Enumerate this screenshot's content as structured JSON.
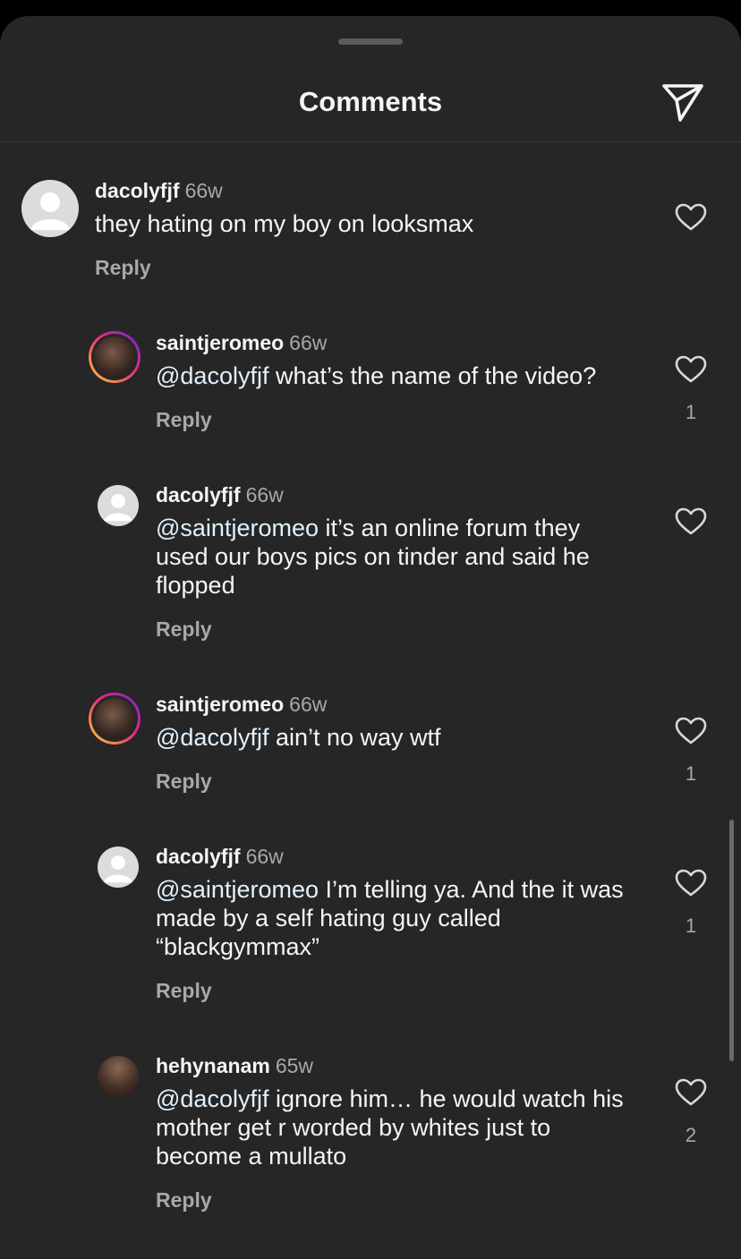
{
  "header": {
    "title": "Comments",
    "share_icon": "paper-plane-icon"
  },
  "comments": [
    {
      "username": "dacolyfjf",
      "time": "66w",
      "mention": "",
      "text": "they hating on my boy on looksmax",
      "reply_label": "Reply",
      "likes": "",
      "avatar": "default-avatar"
    },
    {
      "username": "saintjeromeo",
      "time": "66w",
      "mention": "@dacolyfjf",
      "text": " what’s the name of the video?",
      "reply_label": "Reply",
      "likes": "1",
      "avatar": "story-ring-avatar"
    },
    {
      "username": "dacolyfjf",
      "time": "66w",
      "mention": "@saintjeromeo",
      "text": " it’s an online forum they used our boys pics on tinder and said he flopped",
      "reply_label": "Reply",
      "likes": "",
      "avatar": "default-avatar"
    },
    {
      "username": "saintjeromeo",
      "time": "66w",
      "mention": "@dacolyfjf",
      "text": " ain’t no way wtf",
      "reply_label": "Reply",
      "likes": "1",
      "avatar": "story-ring-avatar"
    },
    {
      "username": "dacolyfjf",
      "time": "66w",
      "mention": "@saintjeromeo",
      "text": " I’m telling ya. And the it was made by a self hating guy called “blackgymmax”",
      "reply_label": "Reply",
      "likes": "1",
      "avatar": "default-avatar"
    },
    {
      "username": "hehynanam",
      "time": "65w",
      "mention": "@dacolyfjf",
      "text": " ignore him… he would watch his mother get r worded by whites just to become a mullato",
      "reply_label": "Reply",
      "likes": "2",
      "avatar": "photo-avatar"
    }
  ],
  "colors": {
    "background": "#262626",
    "text": "#f5f5f5",
    "secondary": "#a8a8a8",
    "mention": "#e0f1ff"
  }
}
